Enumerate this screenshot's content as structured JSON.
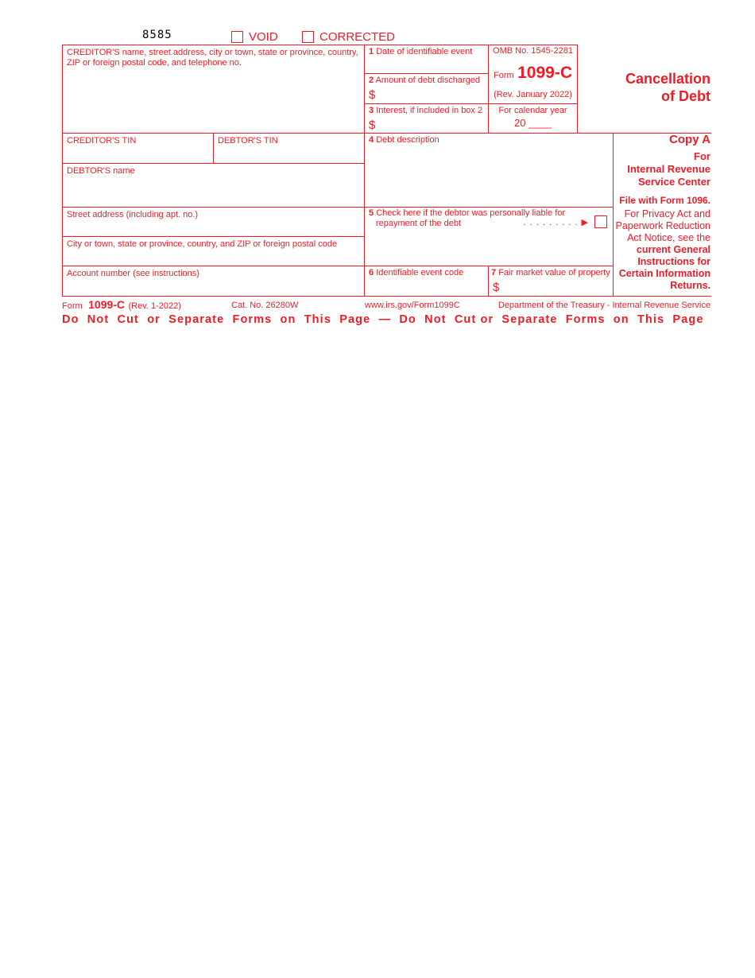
{
  "header": {
    "form_code": "8585",
    "void_label": "VOID",
    "corrected_label": "CORRECTED"
  },
  "left": {
    "creditor_name_label_line1": "CREDITOR'S name, street address, city or town, state or province, country,",
    "creditor_name_label_line2": "ZIP or foreign postal code, and telephone no.",
    "creditor_tin_label": "CREDITOR'S TIN",
    "debtor_tin_label": "DEBTOR'S TIN",
    "debtor_name_label": "DEBTOR'S name",
    "street_label": "Street address (including apt. no.)",
    "city_label": "City or town, state or province, country, and ZIP or foreign postal code",
    "account_label": "Account number (see instructions)"
  },
  "boxes": {
    "box1_num": "1",
    "box1_label": "Date of identifiable event",
    "box2_num": "2",
    "box2_label": "Amount of debt discharged",
    "box3_num": "3",
    "box3_label": "Interest, if included in box 2",
    "box4_num": "4",
    "box4_label": "Debt description",
    "box5_num": "5",
    "box5_label_line1": "Check here if the debtor was personally liable for",
    "box5_label_line2": "repayment of the debt",
    "box5_leader": ". . . . . . . . . ▶",
    "box6_num": "6",
    "box6_label": "Identifiable event code",
    "box7_num": "7",
    "box7_label": "Fair market value of property",
    "currency_symbol": "$"
  },
  "omb": {
    "omb_no": "OMB No. 1545-2281",
    "form_word": "Form",
    "form_number": "1099-C",
    "revision": "(Rev. January 2022)",
    "calendar_year_label": "For calendar year",
    "year_prefix": "20",
    "year_blank": "____"
  },
  "title": {
    "line1": "Cancellation",
    "line2": "of Debt"
  },
  "copy": {
    "copy_label": "Copy A",
    "for": "For",
    "irs1": "Internal Revenue",
    "irs2": "Service Center",
    "file_with": "File with Form 1096.",
    "privacy1": "For Privacy Act and",
    "privacy2": "Paperwork Reduction",
    "privacy3": "Act Notice, see the",
    "privacy4": "current General",
    "privacy5": "Instructions for",
    "privacy6": "Certain Information",
    "privacy7": "Returns."
  },
  "footer": {
    "form_word": "Form",
    "form_number": "1099-C",
    "revision": "(Rev. 1-2022)",
    "cat_no": "Cat. No. 26280W",
    "url": "www.irs.gov/Form1099C",
    "department": "Department of the Treasury - Internal Revenue Service",
    "warning": "Do  Not  Cut  or  Separate  Forms  on  This  Page  —  Do  Not  Cut or  Separate  Forms  on  This  Page"
  },
  "colors": {
    "form_red": "#ee1c25"
  }
}
